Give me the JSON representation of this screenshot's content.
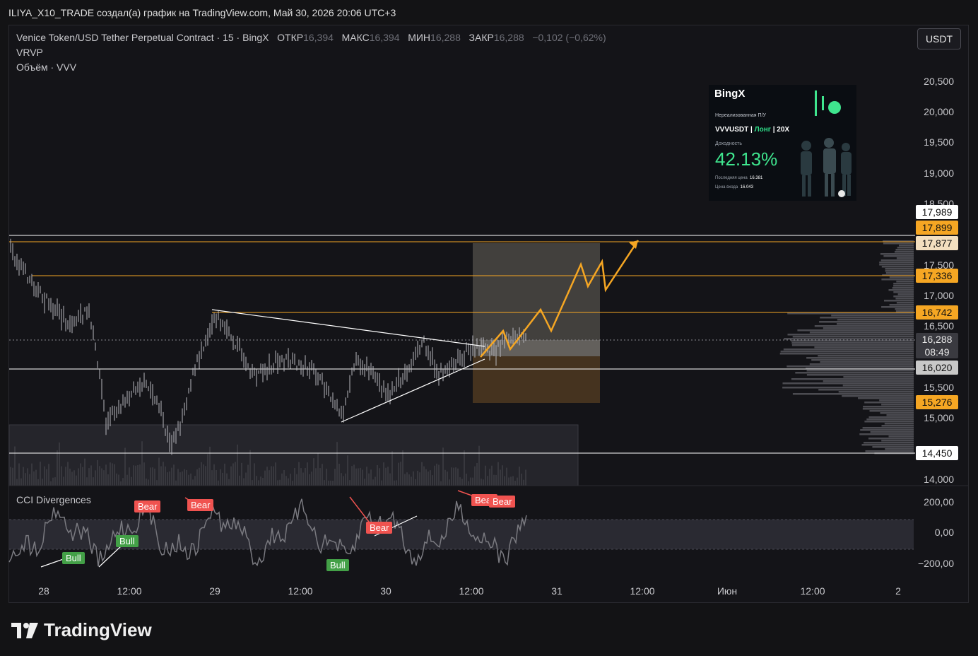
{
  "header": {
    "author_line": "ILIYA_X10_TRADE создал(а) график на TradingView.com, Май 30, 2026 20:06 UTC+3"
  },
  "legend": {
    "symbol": "Venice Token/USD Tether Perpetual Contract · 15 · BingX",
    "open_label": "ОТКР",
    "open_value": "16,394",
    "high_label": "МАКС",
    "high_value": "16,394",
    "low_label": "МИН",
    "low_value": "16,288",
    "close_label": "ЗАКР",
    "close_value": "16,288",
    "change": "−0,102 (−0,62%)",
    "indicator1": "VRVP",
    "indicator2": "Объём · VVV"
  },
  "currency_button": "USDT",
  "price_axis": [
    "20,500",
    "20,000",
    "19,500",
    "19,000",
    "18,500",
    "17,500",
    "17,000",
    "16,500",
    "15,500",
    "15,000",
    "14,000"
  ],
  "price_tags": [
    {
      "value": "17,989",
      "bg": "#ffffff",
      "fg": "#111111"
    },
    {
      "value": "17,899",
      "bg": "#f5a623",
      "fg": "#111111"
    },
    {
      "value": "17,877",
      "bg": "#f3dfbf",
      "fg": "#111111"
    },
    {
      "value": "17,336",
      "bg": "#f5a623",
      "fg": "#111111"
    },
    {
      "value": "16,742",
      "bg": "#f5a623",
      "fg": "#111111"
    },
    {
      "value": "16,020",
      "bg": "#c8c8c8",
      "fg": "#111111"
    },
    {
      "value": "15,276",
      "bg": "#f5a623",
      "fg": "#111111"
    },
    {
      "value": "14,450",
      "bg": "#ffffff",
      "fg": "#111111"
    }
  ],
  "current_price": {
    "value": "16,288",
    "countdown": "08:49"
  },
  "cci": {
    "title": "CCI Divergences",
    "axis": [
      "200,00",
      "0,00",
      "−200,00"
    ],
    "labels": [
      "Bear",
      "Bear",
      "Bear",
      "Bear",
      "Bear",
      "Bull",
      "Bull",
      "Bull"
    ]
  },
  "time_axis": [
    "28",
    "12:00",
    "29",
    "12:00",
    "30",
    "12:00",
    "31",
    "12:00",
    "Июн",
    "12:00",
    "2"
  ],
  "ad": {
    "brand": "BingX",
    "subtitle": "Нереализованная П/У",
    "pair": "VVVUSDT",
    "side": "Лонг",
    "leverage": "20X",
    "yield_label": "Доходность",
    "yield_value": "42.13%",
    "last_price_label": "Последняя цена",
    "last_price": "16.381",
    "entry_label": "Цена входа",
    "entry_price": "16.043"
  },
  "footer": {
    "brand": "TradingView"
  },
  "colors": {
    "orange": "#f5a623",
    "bear": "#f05350",
    "bull": "#43a047",
    "bg": "#131315"
  }
}
